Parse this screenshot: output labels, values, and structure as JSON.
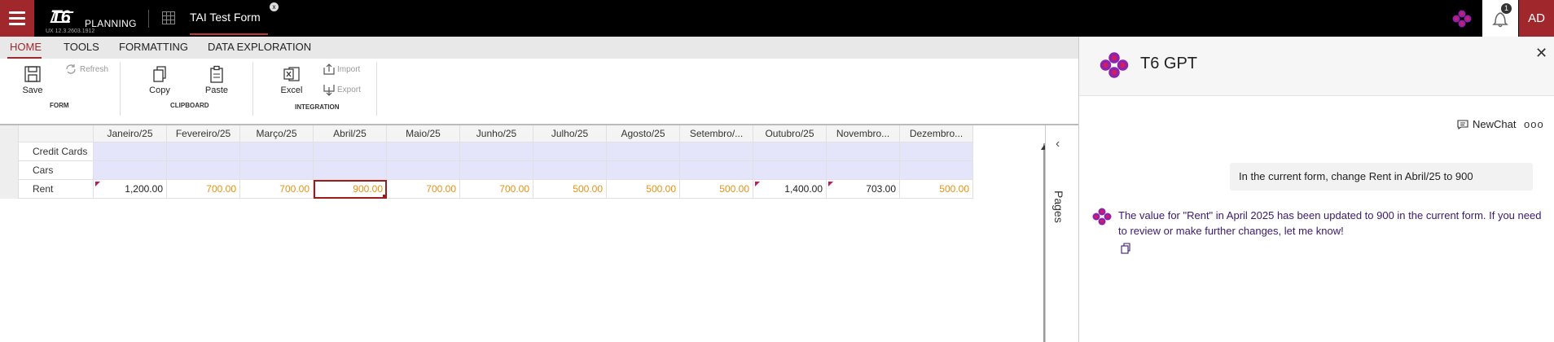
{
  "topbar": {
    "logo_mark": "T6",
    "logo_text": "PLANNING",
    "version": "UX 12.3.2603.1912",
    "form_tab": "TAI Test Form",
    "tab_close": "x",
    "notification_count": "1",
    "user_initials": "AD"
  },
  "ribbon": {
    "tabs": [
      "HOME",
      "TOOLS",
      "FORMATTING",
      "DATA EXPLORATION"
    ],
    "save": "Save",
    "refresh": "Refresh",
    "copy": "Copy",
    "paste": "Paste",
    "excel": "Excel",
    "import": "Import",
    "export": "Export",
    "groups": [
      "FORM",
      "CLIPBOARD",
      "INTEGRATION"
    ]
  },
  "grid": {
    "columns": [
      "Janeiro/25",
      "Fevereiro/25",
      "Março/25",
      "Abril/25",
      "Maio/25",
      "Junho/25",
      "Julho/25",
      "Agosto/25",
      "Setembro/...",
      "Outubro/25",
      "Novembro...",
      "Dezembro..."
    ],
    "rows": [
      {
        "label": "Credit Cards",
        "values": [
          "",
          "",
          "",
          "",
          "",
          "",
          "",
          "",
          "",
          "",
          "",
          ""
        ]
      },
      {
        "label": "Cars",
        "values": [
          "",
          "",
          "",
          "",
          "",
          "",
          "",
          "",
          "",
          "",
          "",
          ""
        ]
      },
      {
        "label": "Rent",
        "values": [
          "1,200.00",
          "700.00",
          "700.00",
          "900.00",
          "700.00",
          "700.00",
          "500.00",
          "500.00",
          "500.00",
          "1,400.00",
          "703.00",
          "500.00"
        ]
      }
    ],
    "rent_colors": [
      "black",
      "orange",
      "orange",
      "orange",
      "orange",
      "orange",
      "orange",
      "orange",
      "orange",
      "black",
      "black",
      "orange"
    ],
    "rent_flags": [
      true,
      false,
      false,
      false,
      false,
      false,
      false,
      false,
      false,
      true,
      true,
      false
    ],
    "selected_column": 3
  },
  "pages_panel": {
    "label": "Pages"
  },
  "gpt": {
    "title": "T6 GPT",
    "new_chat": "NewChat",
    "more": "ooo",
    "user_message": "In the current form, change Rent in Abril/25 to 900",
    "bot_message": "The value for \"Rent\" in April 2025 has been updated to 900 in the current form. If you need to review or make further changes, let me know!"
  },
  "colors": {
    "brand": "#a0282d",
    "accent_orange": "#e69214",
    "bot_text": "#3b1a6e",
    "input_cell": "#e4e5fb"
  }
}
